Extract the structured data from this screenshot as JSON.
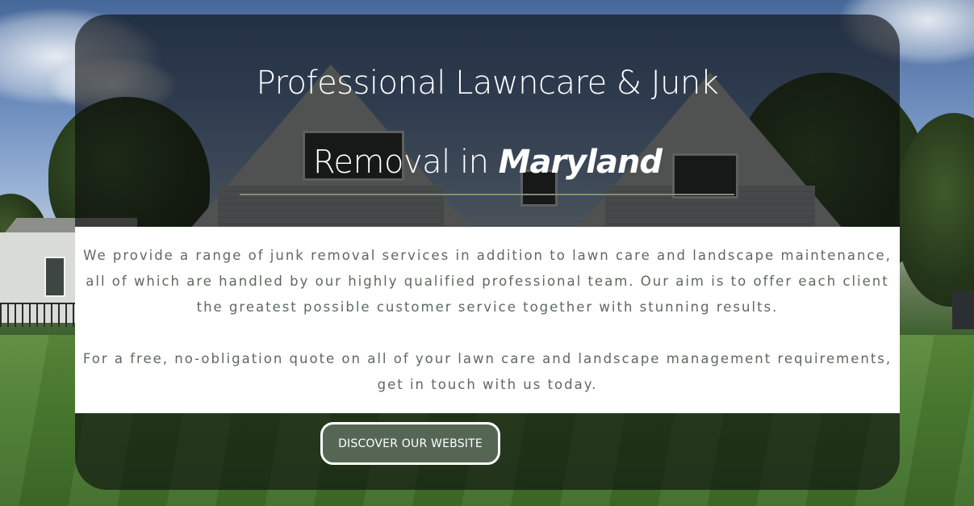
{
  "hero": {
    "heading_line1": "Professional Lawncare & Junk",
    "heading_line2_prefix": "Removal in ",
    "heading_accent": "Maryland",
    "paragraph1": "We provide a range of junk removal services in addition to lawn care and landscape maintenance, all of which are handled by our highly qualified professional team. Our aim is to offer each client the greatest possible customer service together with stunning results.",
    "paragraph2": "For a free, no-obligation quote on all of your lawn care and landscape management requirements, get in touch with us today.",
    "cta_label": "DISCOVER OUR WEBSITE"
  },
  "colors": {
    "card_overlay": "#0a0c0c",
    "button_fill": "#566655",
    "body_text": "#5d6a5c",
    "divider": "#7f8f76"
  }
}
